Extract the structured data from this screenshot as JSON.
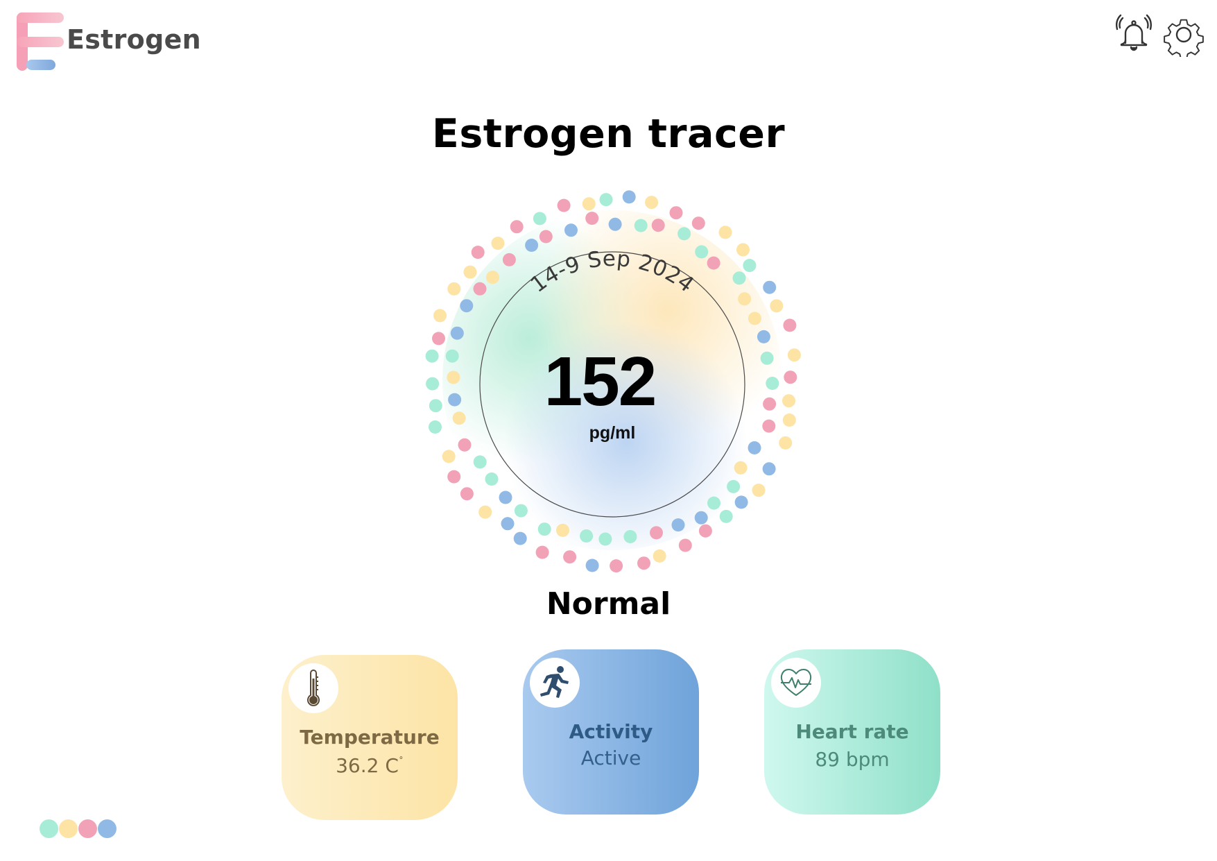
{
  "app": {
    "name": "Estrogen",
    "logo_letter": "E"
  },
  "header": {
    "icons": [
      "bell-icon",
      "gear-icon"
    ]
  },
  "page": {
    "title": "Estrogen tracer"
  },
  "reading": {
    "date_range": "14-9 Sep 2024",
    "value": "152",
    "unit": "pg/ml",
    "status": "Normal"
  },
  "cards": {
    "temperature": {
      "label": "Temperature",
      "value": "36.2 C",
      "degree_mark": "˚",
      "icon": "thermometer-icon"
    },
    "activity": {
      "label": "Activity",
      "value": "Active",
      "icon": "running-person-icon"
    },
    "heart_rate": {
      "label": "Heart rate",
      "value": "89 bpm",
      "icon": "heart-pulse-icon"
    }
  },
  "colors": {
    "mint": "#a6ecd6",
    "yellow": "#fde3a4",
    "pink": "#f2a2b6",
    "blue": "#91b9e6",
    "text_dark": "#4a4a4a"
  },
  "pager": {
    "dots": [
      "mint",
      "yellow",
      "pink",
      "blue"
    ]
  }
}
